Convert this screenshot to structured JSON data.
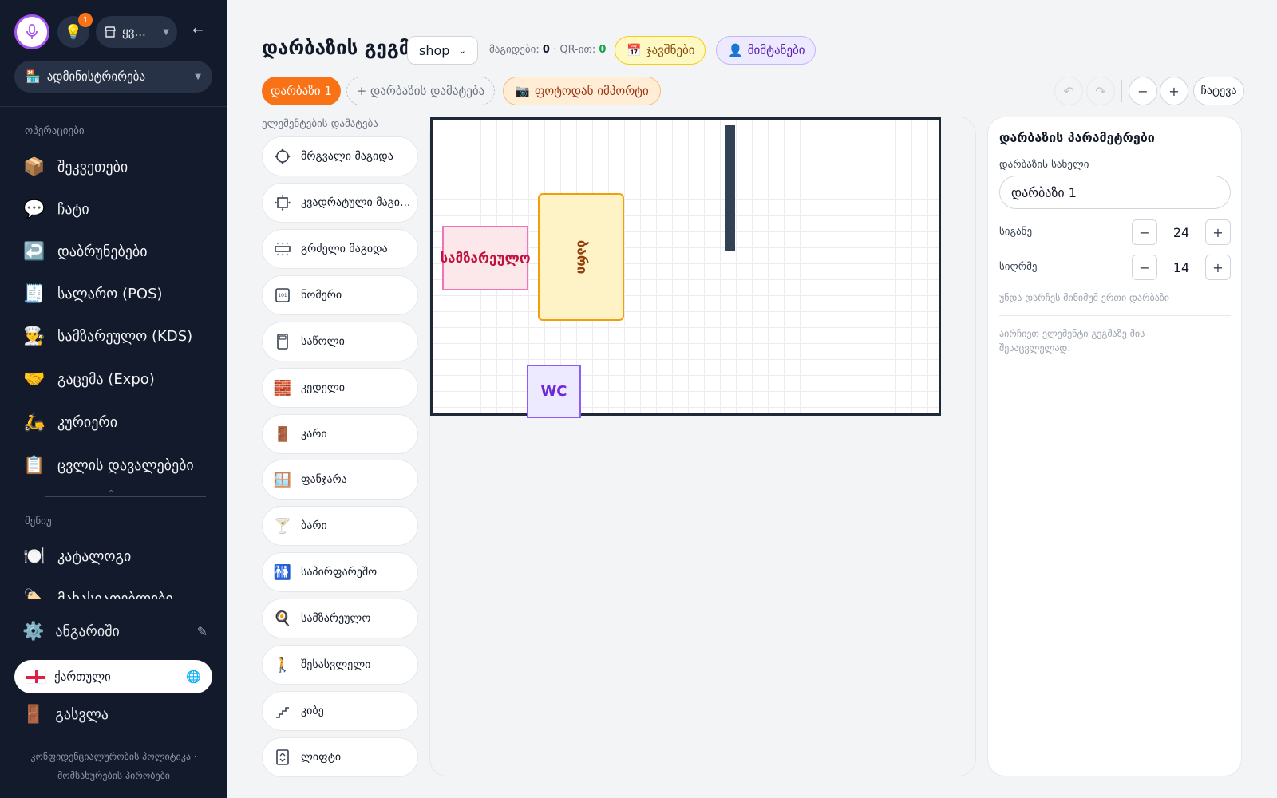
{
  "sidebar": {
    "notification_count": "1",
    "store_name": "ყვ...",
    "admin_select": "ადმინისტრირება",
    "section_operations": "ოპერაციები",
    "operations_items": [
      {
        "label": "შეკვეთები",
        "icon": "📦"
      },
      {
        "label": "ჩატი",
        "icon": "💬"
      },
      {
        "label": "დაბრუნებები",
        "icon": "↩️"
      },
      {
        "label": "სალარო (POS)",
        "icon": "🧾"
      },
      {
        "label": "სამზარეულო (KDS)",
        "icon": "👨‍🍳"
      },
      {
        "label": "გაცემა (Expo)",
        "icon": "🤝"
      },
      {
        "label": "კურიერი",
        "icon": "🛵"
      },
      {
        "label": "ცვლის დავალებები",
        "icon": "📋"
      }
    ],
    "section_menu": "მენიუ",
    "menu_items": [
      {
        "label": "კატალოგი",
        "icon": "🍽️"
      },
      {
        "label": "მახასიათებლები",
        "icon": "🏷️"
      }
    ],
    "account": "ანგარიში",
    "language": "ქართული",
    "logout": "გასვლა",
    "footer_privacy": "კონფიდენციალურობის პოლიტიკა",
    "footer_dot": "·",
    "footer_terms": "მომსახურების პირობები"
  },
  "header": {
    "title": "დარბაზის გეგმა",
    "shop_select": "shop",
    "stats_prefix": "მაგიდები: ",
    "tables_count": "0",
    "stats_mid": " · QR-ით: ",
    "qr_count": "0",
    "bookings": "ჯავშნები",
    "bookings_icon": "📅",
    "guests": "მიმტანები",
    "guests_icon": "👤",
    "hall_tab": "დარბაზი 1",
    "add_hall": "+ დარბაზის დამატება",
    "import_photo": "ფოტოდან იმპორტი",
    "import_icon": "📷",
    "undo": "↶",
    "redo": "↷",
    "zoom_out": "−",
    "zoom_in": "+",
    "save": "ჩატევა"
  },
  "palette": {
    "title": "ელემენტების დამატება",
    "items": [
      {
        "label": "მრგვალი მაგიდა",
        "icon": "round-table-icon"
      },
      {
        "label": "კვადრატული მაგი...",
        "icon": "square-table-icon"
      },
      {
        "label": "გრძელი მაგიდა",
        "icon": "long-table-icon"
      },
      {
        "label": "ნომერი",
        "icon": "number-icon"
      },
      {
        "label": "საწოლი",
        "icon": "bed-icon"
      },
      {
        "label": "კედელი",
        "icon": "🧱"
      },
      {
        "label": "კარი",
        "icon": "🚪"
      },
      {
        "label": "ფანჯარა",
        "icon": "🪟"
      },
      {
        "label": "ბარი",
        "icon": "🍸"
      },
      {
        "label": "საპირფარეშო",
        "icon": "🚻"
      },
      {
        "label": "სამზარეულო",
        "icon": "🍳"
      },
      {
        "label": "შესასვლელი",
        "icon": "🚶"
      },
      {
        "label": "კიბე",
        "icon": "stairs-icon"
      },
      {
        "label": "ლიფტი",
        "icon": "elevator-icon"
      }
    ]
  },
  "canvas": {
    "kitchen_label": "სამზარეულო",
    "bar_label": "ბარი",
    "wc_label": "WC"
  },
  "panel": {
    "title": "დარბაზის პარამეტრები",
    "name_label": "დარბაზის სახელი",
    "name_value": "დარბაზი 1",
    "width_label": "სიგანე",
    "width_value": "24",
    "depth_label": "სიღრმე",
    "depth_value": "14",
    "minus": "−",
    "plus": "+",
    "note_min": "უნდა დარჩეს მინიმუმ ერთი დარბაზი",
    "note_select": "აირჩიეთ ელემენტი გეგმაზე მის შესაცვლელად."
  },
  "colors": {
    "accent_orange": "#f97316",
    "sidebar_bg": "#121a2c",
    "mic_ring": "#a855f7"
  }
}
